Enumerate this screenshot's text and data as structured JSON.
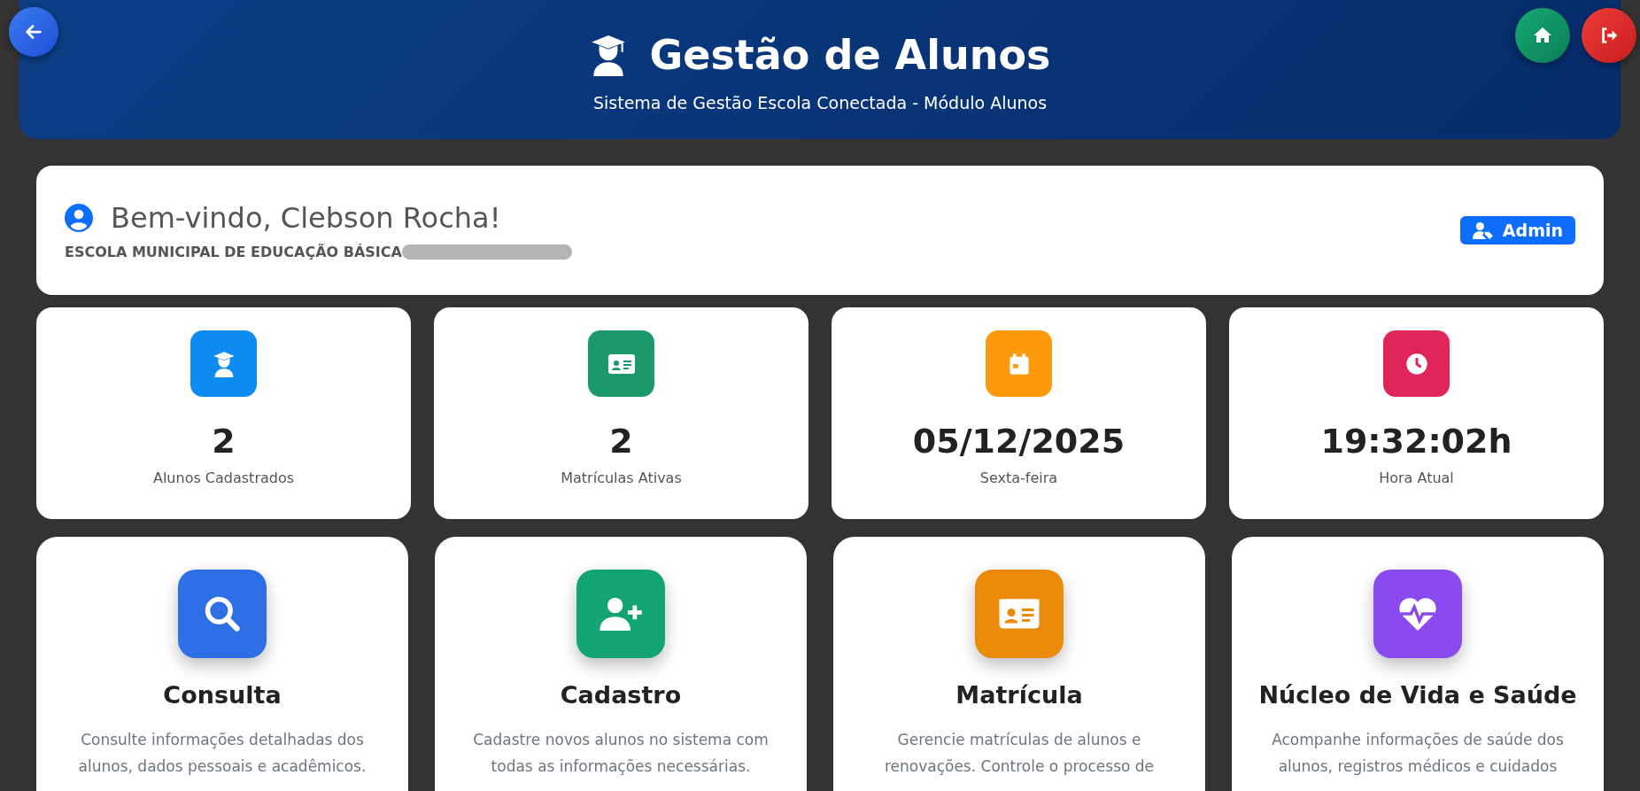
{
  "header": {
    "title": "Gestão de Alunos",
    "subtitle": "Sistema de Gestão Escola Conectada - Módulo Alunos"
  },
  "welcome": {
    "greeting": "Bem-vindo, Clebson Rocha!",
    "school": "ESCOLA MUNICIPAL DE EDUCAÇÃO BÁSICA",
    "role": "Admin"
  },
  "stats": [
    {
      "kind": "students",
      "value": "2",
      "label": "Alunos Cadastrados",
      "color": "#0d8bf0"
    },
    {
      "kind": "enrollment",
      "value": "2",
      "label": "Matrículas Ativas",
      "color": "#1a9a6a"
    },
    {
      "kind": "calendar",
      "value": "05/12/2025",
      "label": "Sexta-feira",
      "color": "#fd9a0c"
    },
    {
      "kind": "clock",
      "value": "19:32:02h",
      "label": "Hora Atual",
      "color": "#e0245c"
    }
  ],
  "modules": [
    {
      "kind": "search",
      "title": "Consulta",
      "description": [
        "Consulte informações detalhadas dos",
        "alunos, dados pessoais e acadêmicos."
      ],
      "color": "#2f6fe6"
    },
    {
      "kind": "add-user",
      "title": "Cadastro",
      "description": [
        "Cadastre novos alunos no sistema com",
        "todas as informações necessárias."
      ],
      "color": "#12a474"
    },
    {
      "kind": "enrollment",
      "title": "Matrícula",
      "description": [
        "Gerencie matrículas de alunos e",
        "renovações. Controle o processo de"
      ],
      "color": "#ea8a08"
    },
    {
      "kind": "health",
      "title": "Núcleo de Vida e Saúde",
      "description": [
        "Acompanhe informações de saúde dos",
        "alunos, registros médicos e cuidados"
      ],
      "color": "#8b4af0"
    }
  ]
}
